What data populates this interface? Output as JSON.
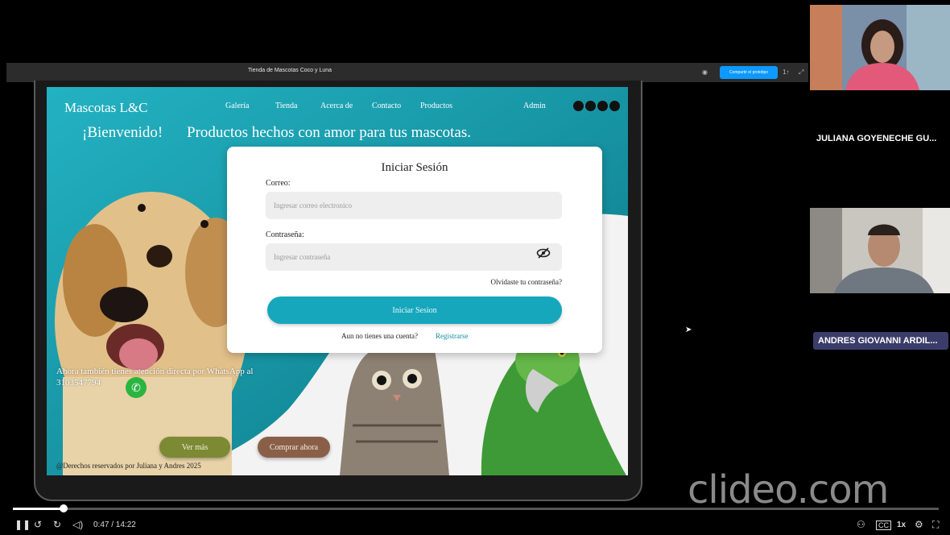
{
  "toolbar": {
    "file_title": "Tienda de Mascotas Coco y Luna",
    "share_label": "Compartir el prototipo",
    "extra_label": "1↑"
  },
  "site": {
    "logo": "Mascotas L&C",
    "nav": [
      "Galería",
      "Tienda",
      "Acerca de",
      "Contacto",
      "Productos",
      "Admin"
    ],
    "socials": [
      "whatsapp-icon",
      "instagram-icon",
      "facebook-icon",
      "youtube-icon"
    ],
    "welcome": "¡Bienvenido!",
    "tagline": "Productos hechos con amor para tus mascotas.",
    "colors": {
      "teal": "#16a0b2",
      "olive": "#7c8a34",
      "brown": "#8a5f48"
    },
    "login": {
      "title": "Iniciar Sesión",
      "email_label": "Correo:",
      "email_placeholder": "Ingresar correo electronico",
      "password_label": "Contraseña:",
      "password_placeholder": "Ingresar contraseña",
      "forgot": "Olvidaste tu contraseña?",
      "submit": "Iniciar Sesion",
      "no_account": "Aun no tienes una cuenta?",
      "register": "Registrarse"
    },
    "whatsapp_text": "Ahora también tienes atención directa por WhatsApp al 3103547794",
    "ver_mas": "Ver más",
    "comprar": "Comprar ahora",
    "copyright": "@Derechos reservados por Juliana y Andres 2025"
  },
  "participants": [
    {
      "name": "JULIANA GOYENECHE GU..."
    },
    {
      "name": "ANDRES GIOVANNI ARDIL..."
    }
  ],
  "watermark": "clideo.com",
  "player": {
    "time": "0:47 / 14:22",
    "progress": 0.055,
    "speed": "1x"
  }
}
